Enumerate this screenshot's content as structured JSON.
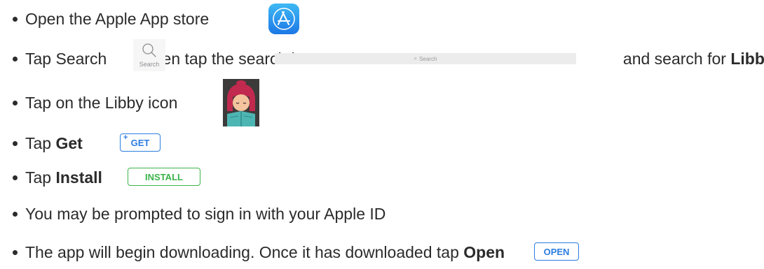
{
  "steps": [
    {
      "text": "Open the Apple App store"
    },
    {
      "pre": "Tap Search",
      "mid": "then tap the search bar",
      "post": "and search for ",
      "bold": "Libby"
    },
    {
      "text": "Tap on the Libby icon"
    },
    {
      "pre": "Tap ",
      "bold": "Get"
    },
    {
      "pre": "Tap ",
      "bold": "Install"
    },
    {
      "text": "You may be prompted to sign in with your Apple ID"
    },
    {
      "pre": "The app will begin downloading. Once it has downloaded tap ",
      "bold": "Open"
    }
  ],
  "icons": {
    "appstore": "app-store-icon",
    "search_tab_label": "Search",
    "search_bar_placeholder": "Search",
    "libby": "libby-app-icon"
  },
  "buttons": {
    "get": "GET",
    "install": "INSTALL",
    "open": "OPEN"
  },
  "colors": {
    "text": "#2b2b2b",
    "app_store_blue": "#1c78e6",
    "ios_blue": "#2b7de0",
    "install_green": "#3cb44a"
  }
}
